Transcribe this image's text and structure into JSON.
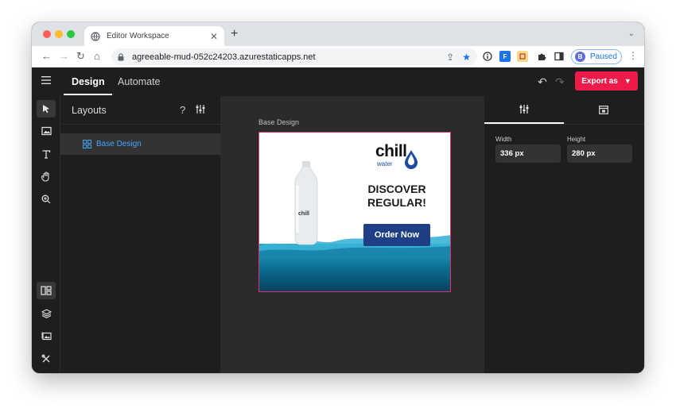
{
  "browser": {
    "tab_title": "Editor Workspace",
    "new_tab": "+",
    "url": "agreeable-mud-052c24203.azurestaticapps.net",
    "profile_initial": "B",
    "profile_status": "Paused"
  },
  "app": {
    "tabs": [
      {
        "label": "Design"
      },
      {
        "label": "Automate"
      }
    ],
    "export_label": "Export as",
    "layouts_panel": {
      "title": "Layouts",
      "help": "?",
      "items": [
        {
          "label": "Base Design"
        }
      ]
    },
    "canvas": {
      "design_label": "Base Design",
      "banner": {
        "logo_text": "chill",
        "logo_sub": "water",
        "headline_line1": "DISCOVER",
        "headline_line2": "REGULAR!",
        "cta": "Order Now",
        "bottle_label": "chill"
      }
    },
    "properties": {
      "width_label": "Width",
      "width_value": "336 px",
      "height_label": "Height",
      "height_value": "280 px"
    }
  },
  "colors": {
    "accent": "#ec1b4a",
    "selection_blue": "#3fa7ff",
    "cta_blue": "#1e3f86"
  }
}
